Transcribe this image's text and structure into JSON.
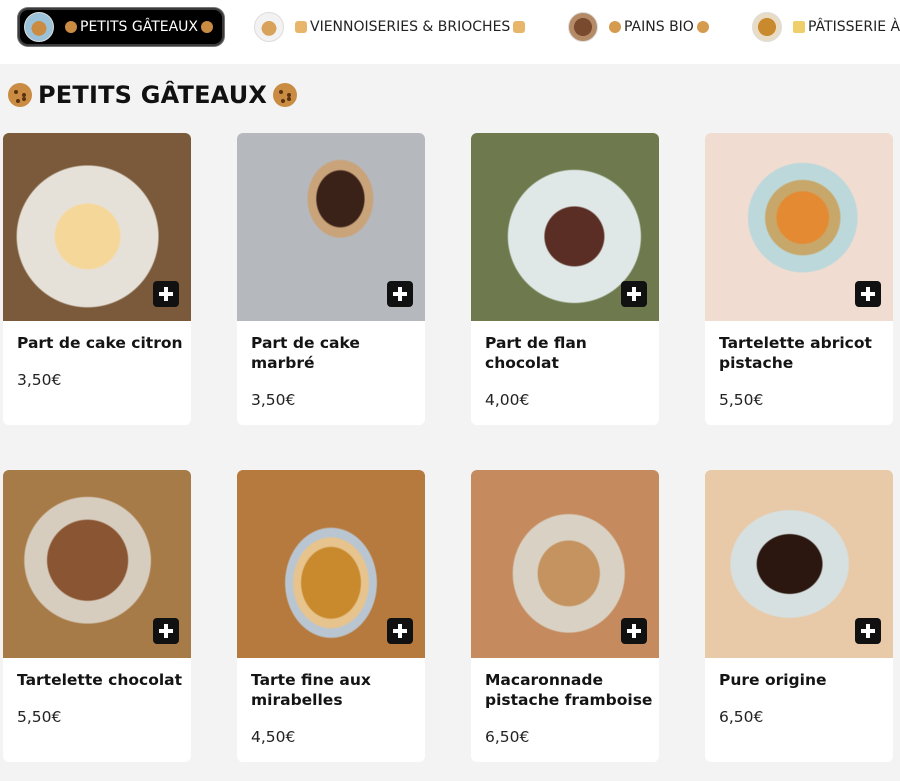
{
  "categories": [
    {
      "label": "PETITS GÂTEAUX",
      "active": true
    },
    {
      "label": "VIENNOISERIES & BRIOCHES",
      "active": false
    },
    {
      "label": "PAINS BIO",
      "active": false
    },
    {
      "label": "PÂTISSERIE À",
      "active": false
    }
  ],
  "section": {
    "title": "PETITS GÂTEAUX"
  },
  "products": [
    {
      "name": "Part de cake citron",
      "price": "3,50€"
    },
    {
      "name": "Part de cake marbré",
      "price": "3,50€"
    },
    {
      "name": "Part de flan chocolat",
      "price": "4,00€"
    },
    {
      "name": "Tartelette abricot pistache",
      "price": "5,50€"
    },
    {
      "name": "Tartelette chocolat",
      "price": "5,50€"
    },
    {
      "name": "Tarte fine aux mirabelles",
      "price": "4,50€"
    },
    {
      "name": "Macaronnade pistache framboise",
      "price": "6,50€"
    },
    {
      "name": "Pure origine",
      "price": "6,50€"
    }
  ]
}
